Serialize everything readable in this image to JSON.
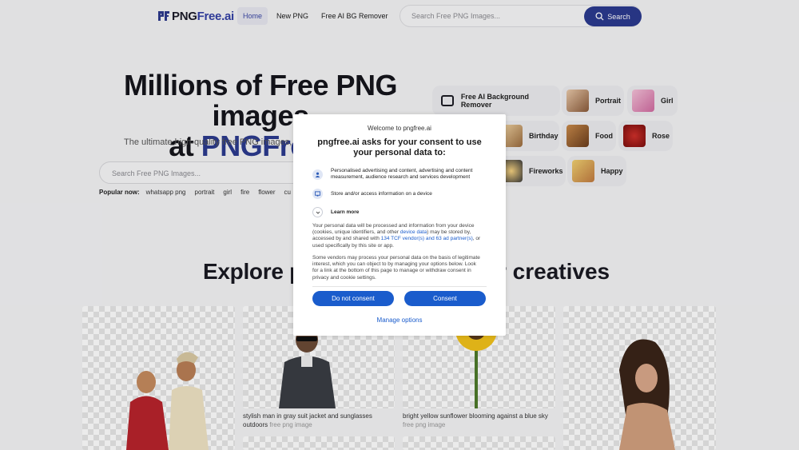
{
  "header": {
    "logo_part1": "PNG",
    "logo_part2": "Free.ai",
    "nav": [
      "Home",
      "New PNG",
      "Free AI BG Remover"
    ],
    "search_placeholder": "Search Free PNG Images...",
    "search_button": "Search"
  },
  "hero": {
    "title_line1": "Millions of Free PNG images",
    "title_at": "at",
    "title_brand": "PNGFree.ai",
    "subtitle": "The ultimate high-quality free PNG images, free l",
    "search_placeholder": "Search Free PNG Images...",
    "popular_label": "Popular now:",
    "popular_tags": [
      "whatsapp png",
      "portrait",
      "girl",
      "fire",
      "flower",
      "cu"
    ]
  },
  "categories": {
    "bg_remover": "Free AI Background Remover",
    "items": [
      "Portrait",
      "Girl",
      "Birthday",
      "Food",
      "Rose",
      "Fireworks",
      "Happy"
    ]
  },
  "explore": {
    "left": "Explore po",
    "right": "r creatives"
  },
  "gallery": {
    "caption1": "stylish man in gray suit jacket and sunglasses outdoors",
    "caption1_suffix": "free png image",
    "caption2": "bright yellow sunflower blooming against a blue sky",
    "caption2_suffix": "free png image"
  },
  "consent": {
    "welcome": "Welcome to pngfree.ai",
    "title": "pngfree.ai asks for your consent to use your personal data to:",
    "purpose1": "Personalised advertising and content, advertising and content measurement, audience research and services development",
    "purpose2": "Store and/or access information on a device",
    "learn_more": "Learn more",
    "para1_a": "Your personal data will be processed and information from your device (cookies, unique identifiers, and other",
    "para1_link1": "device data",
    "para1_b": ") may be stored by, accessed by and shared with",
    "para1_link2": "134 TCF vendor(s) and 63 ad partner(s)",
    "para1_c": ", or used specifically by this site or app.",
    "para2": "Some vendors may process your personal data on the basis of legitimate interest, which you can object to by managing your options below. Look for a link at the bottom of this page to manage or withdraw consent in privacy and cookie settings.",
    "deny_button": "Do not consent",
    "consent_button": "Consent",
    "manage_options": "Manage options"
  },
  "colors": {
    "brand": "#2b3a8f",
    "consent_blue": "#1a5ccc"
  }
}
